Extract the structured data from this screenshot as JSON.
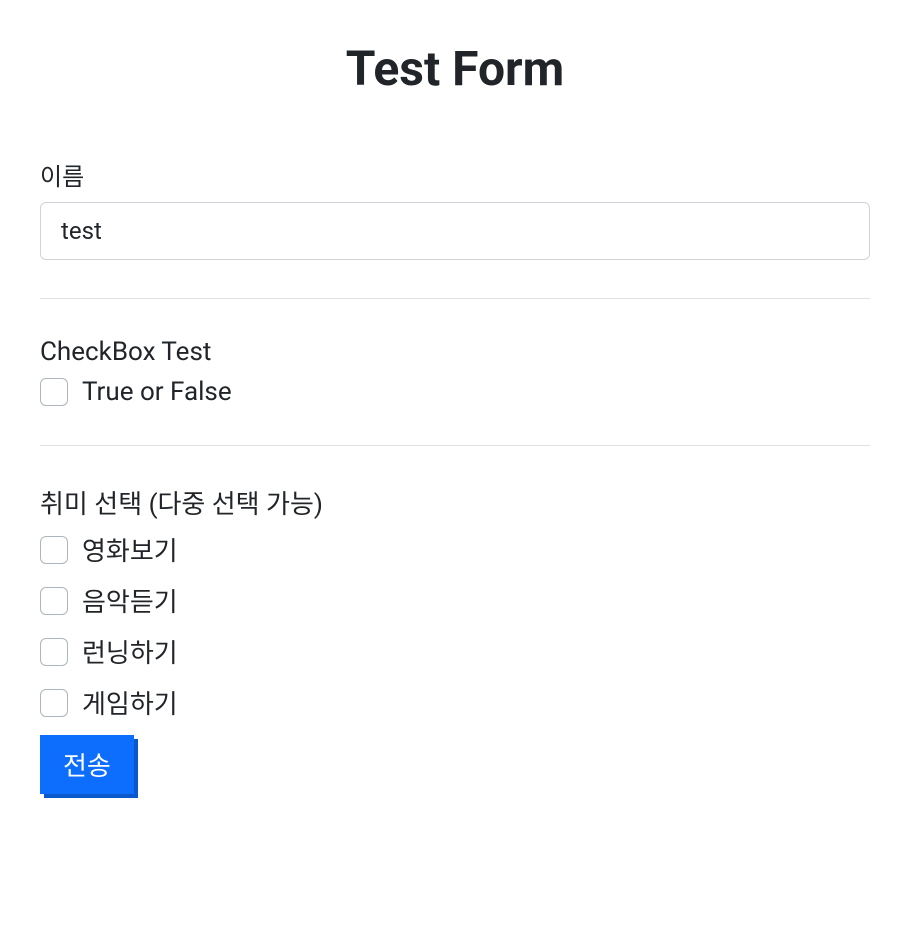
{
  "header": {
    "title": "Test Form"
  },
  "form": {
    "name": {
      "label": "이름",
      "value": "test"
    },
    "checkbox_test": {
      "section_label": "CheckBox Test",
      "option_label": "True or False"
    },
    "hobbies": {
      "section_label": "취미 선택 (다중 선택 가능)",
      "options": [
        {
          "label": "영화보기"
        },
        {
          "label": "음악듣기"
        },
        {
          "label": "런닝하기"
        },
        {
          "label": "게임하기"
        }
      ]
    },
    "submit_label": "전송"
  }
}
